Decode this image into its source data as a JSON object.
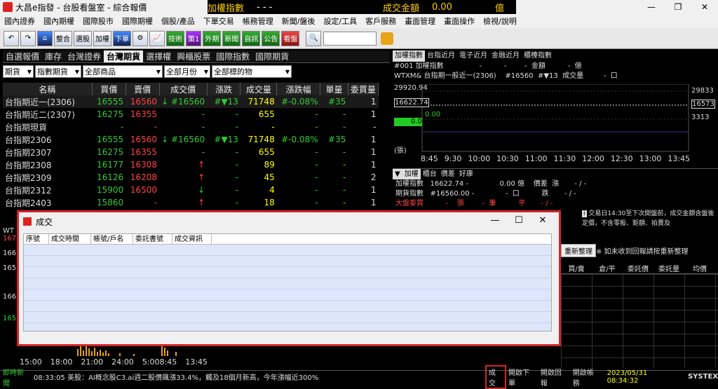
{
  "window": {
    "title": "大昌e指發 - 台股看盤室 - 綜合報價",
    "ticker_name": "加權指數",
    "ticker_value": "- - -",
    "ticker_amount_label": "成交金額",
    "ticker_amount": "0.00",
    "ticker_unit": "億",
    "min": "—",
    "max": "❐",
    "close": "✕"
  },
  "menu": [
    "國內證券",
    "國內期權",
    "國際股市",
    "國際期權",
    "個股/產品",
    "下單交易",
    "帳務管理",
    "新聞/盤後",
    "設定/工具",
    "客戶服務",
    "畫面管理",
    "畫面操作",
    "檢視/說明"
  ],
  "toolbar": [
    "↶",
    "↷",
    "⌂",
    "整合",
    "選股",
    "加權",
    "下單",
    "⚙",
    "📈",
    "技術",
    "策1",
    "外期",
    "新聞",
    "自訊",
    "公告",
    "看盤"
  ],
  "quote_tabs": [
    "自選報價",
    "庫存",
    "台灣證券",
    "台灣期貨",
    "選擇權",
    "興櫃股票",
    "國際指數",
    "國際期貨"
  ],
  "quote_active_tab": "台灣期貨",
  "filters": [
    "期貨",
    "指數期貨",
    "全部商品",
    "全部月份",
    "全部標的物"
  ],
  "columns": [
    "名稱",
    "買價",
    "賣價",
    "成交價",
    "漲跌",
    "成交量",
    "漲跌幅",
    "單量",
    "委買量"
  ],
  "rows": [
    [
      "台指期近一(2306)",
      "16555",
      "16560",
      "↓ #16560",
      "#▼13",
      "71748",
      "#-0.08%",
      "#35",
      "1"
    ],
    [
      "台指期近二(2307)",
      "16275",
      "16355",
      "-",
      "-",
      "655",
      "-",
      "-",
      "1"
    ],
    [
      "台指期現貨",
      "-",
      "-",
      "-",
      "-",
      "-",
      "-",
      "-",
      "-"
    ],
    [
      "台指期2306",
      "16555",
      "16560",
      "↓ #16560",
      "#▼13",
      "71748",
      "#-0.08%",
      "#35",
      "1"
    ],
    [
      "台指期2307",
      "16275",
      "16355",
      "-",
      "-",
      "655",
      "-",
      "-",
      "1"
    ],
    [
      "台指期2308",
      "16177",
      "16308",
      "↑",
      "-",
      "89",
      "-",
      "-",
      "1"
    ],
    [
      "台指期2309",
      "16126",
      "16208",
      "↑",
      "-",
      "45",
      "-",
      "-",
      "2"
    ],
    [
      "台指期2312",
      "15900",
      "16500",
      "↓",
      "-",
      "4",
      "-",
      "-",
      "1"
    ],
    [
      "台指期2403",
      "15860",
      "-",
      "↑",
      "-",
      "18",
      "-",
      "-",
      "1"
    ]
  ],
  "right": {
    "tabs": [
      "加權指數",
      "台指近月",
      "電子近月",
      "金融近月",
      "櫃檯指數"
    ],
    "line1": "#001 加權指數                -          -        -  金額          -  億",
    "line2": "WTXM& 台指期一般近一(2306)    #16560  #▼13  成交量         -  口",
    "ylabels": [
      "29920.94",
      "16622.74",
      "0.00"
    ],
    "yright": [
      "29833",
      "16573",
      "3313"
    ],
    "marker": "0.00",
    "unit": "(張)",
    "xaxis": [
      "8:45",
      "9:30",
      "10:00",
      "10:30",
      "11:00",
      "11:30",
      "12:00",
      "12:30",
      "13:00",
      "13:45"
    ],
    "detail_tabs": [
      "加權",
      "櫃台",
      "價差",
      "好康"
    ],
    "detail1": "加權指數   16622.74 -              0.00 億    價差  漲       - / -",
    "detail2": "期貨指數   #16560.00 -              -  口          跌       - / -",
    "detail3": "大盤委買          -    張        -  筆          平       - / -",
    "notice": "交易日14:30至下次開盤前，成交金額含盤後定價，不含零股、鉅額、拍賣及"
  },
  "dialog": {
    "title": "成交",
    "columns": [
      "序號",
      "成交時間",
      "帳號/戶名",
      "委託書號",
      "成交資訊"
    ],
    "min": "—",
    "max": "☐",
    "close": "✕"
  },
  "right_lower": {
    "refresh": "重新整理",
    "note": "※ 如未收到回報請按重新整理",
    "columns": [
      "買/賣",
      "倉/平",
      "委託價",
      "委託量",
      "均價"
    ]
  },
  "bottom_axis": [
    "15:00",
    "18:00",
    "21:00",
    "24:00",
    "5:00",
    "8:45",
    "13:45"
  ],
  "bottom_left_labels": [
    "WT",
    "167",
    "166",
    "165",
    "166",
    "165"
  ],
  "status": {
    "news_label": "即時新聞",
    "news": "08:33:05 美股：AI概念股C3.ai週二股價飆漲33.4%，觸及18個月新高，今年漲幅近300%",
    "btn_trade": "成交",
    "btn_order": "開啟下單",
    "btn_report": "開啟回報",
    "btn_account": "開啟帳務",
    "time": "2023/05/31 08:34:32",
    "brand": "SYSTEX"
  }
}
